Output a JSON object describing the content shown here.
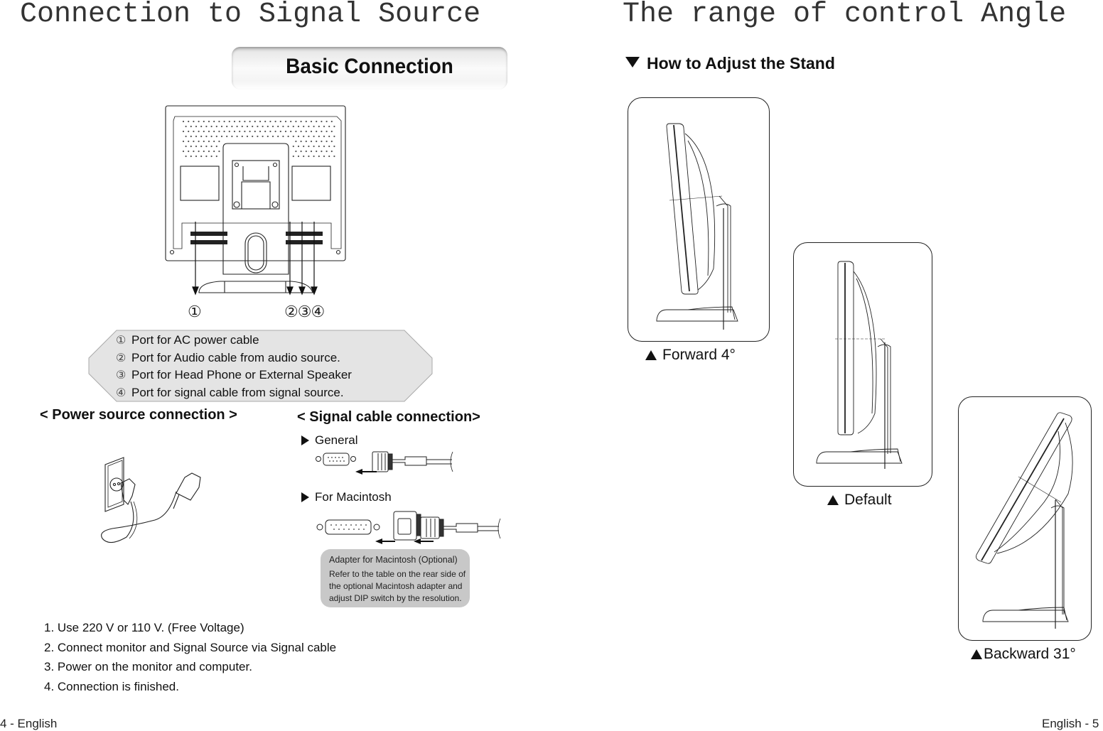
{
  "left_page": {
    "title": "Connection to Signal Source",
    "section_button": "Basic Connection",
    "port_callouts": [
      "①",
      "②③④"
    ],
    "port_legend": [
      {
        "num": "①",
        "text": "Port for AC power cable"
      },
      {
        "num": "②",
        "text": "Port for Audio cable  from audio source."
      },
      {
        "num": "③",
        "text": "Port for Head Phone or External Speaker"
      },
      {
        "num": "④",
        "text": "Port for signal cable from signal source."
      }
    ],
    "power_heading": "< Power source connection >",
    "signal_heading": "< Signal cable connection>",
    "signal_options": [
      "General",
      "For Macintosh"
    ],
    "adapter_note": {
      "title": "Adapter for Macintosh (Optional)",
      "lines": [
        "Refer to the table on the rear side of",
        "the optional Macintosh adapter and",
        "adjust DIP switch by the resolution."
      ]
    },
    "steps": [
      "1. Use 220 V or 110 V. (Free Voltage)",
      "2. Connect monitor and Signal Source via Signal cable",
      "3. Power on the monitor and computer.",
      "4. Connection is finished."
    ],
    "footer": "4 - English"
  },
  "right_page": {
    "title": "The range of control  Angle",
    "subheading": "How to Adjust the Stand",
    "positions": [
      {
        "label": "Forward 4°",
        "tilt_degrees": -4
      },
      {
        "label": "Default",
        "tilt_degrees": 0
      },
      {
        "label": "Backward  31°",
        "tilt_degrees": 31
      }
    ],
    "footer": "English - 5"
  }
}
